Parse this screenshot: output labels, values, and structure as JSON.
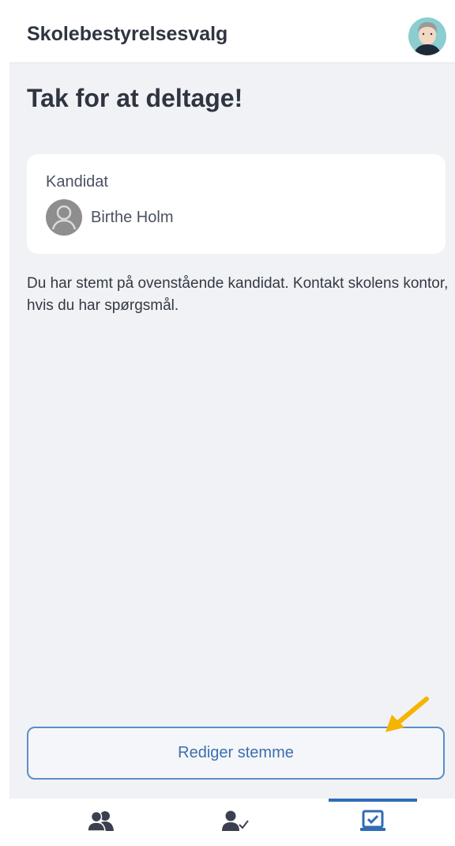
{
  "header": {
    "title": "Skolebestyrelsesvalg",
    "avatar_icon": "user-avatar"
  },
  "main": {
    "heading": "Tak for at deltage!",
    "candidate_card": {
      "label": "Kandidat",
      "candidate_name": "Birthe Holm",
      "avatar_icon": "person-placeholder-icon"
    },
    "info_text": "Du har stemt på ovenstående kandidat. Kontakt skolens kontor, hvis du har spørgsmål.",
    "edit_button_label": "Rediger stemme"
  },
  "bottom_nav": {
    "items": [
      {
        "icon": "people-icon",
        "active": false
      },
      {
        "icon": "person-check-icon",
        "active": false
      },
      {
        "icon": "ballot-check-icon",
        "active": true
      }
    ]
  },
  "colors": {
    "accent": "#2f6db5",
    "button_border": "#5b8ec7",
    "background": "#f1f2f5",
    "annotation_arrow": "#f5b400"
  }
}
